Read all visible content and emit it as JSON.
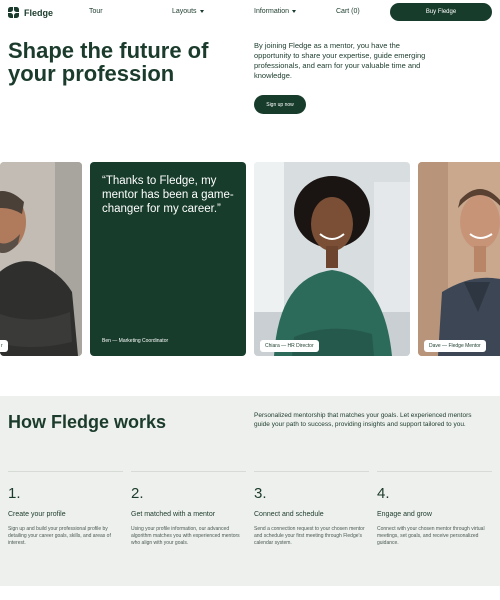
{
  "nav": {
    "brand": "Fledge",
    "tour": "Tour",
    "layouts": "Layouts",
    "information": "Information",
    "cart": "Cart (0)",
    "buy_button": "Buy Fledge"
  },
  "hero": {
    "title": "Shape the future of your profession",
    "description": "By joining Fledge as a mentor, you have the opportunity to share your expertise, guide emerging professionals, and earn for your valuable time and knowledge.",
    "signup_button": "Sign up now"
  },
  "cards": {
    "card0_label": "r",
    "quote": "“Thanks to Fledge, my mentor has been a game-changer for my career.”",
    "quote_attribution": "Ben — Marketing Coordinator",
    "card2_label": "Chiara — HR Director",
    "card3_label": "Dave — Fledge Mentor"
  },
  "how": {
    "title": "How Fledge works",
    "description": "Personalized mentorship that matches your goals. Let experienced mentors guide your path to success, providing insights and support tailored to you.",
    "steps": [
      {
        "number": "1.",
        "title": "Create your profile",
        "text": "Sign up and build your professional profile by detailing your career goals, skills, and areas of interest."
      },
      {
        "number": "2.",
        "title": "Get matched with a mentor",
        "text": "Using your profile information, our advanced algorithm matches you with experienced mentors who align with your goals."
      },
      {
        "number": "3.",
        "title": "Connect and schedule",
        "text": "Send a connection request to your chosen mentor and schedule your first meeting through Fledge's calendar system."
      },
      {
        "number": "4.",
        "title": "Engage and grow",
        "text": "Connect with your chosen mentor through virtual meetings, set goals, and receive personalized guidance."
      }
    ]
  },
  "colors": {
    "brand_dark_green": "#173c2b",
    "section_background": "#eef0ed"
  }
}
